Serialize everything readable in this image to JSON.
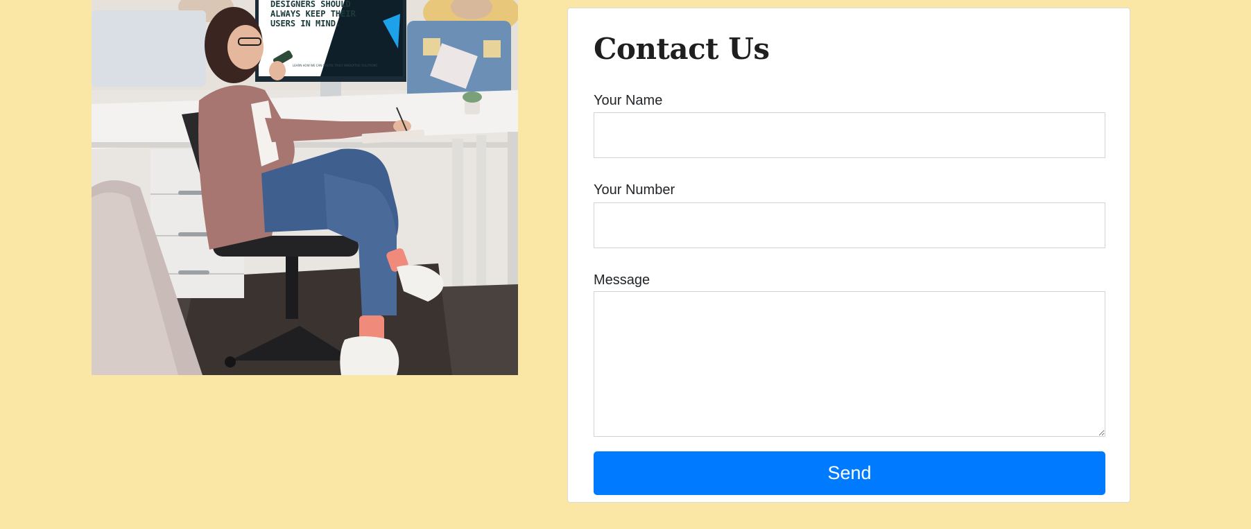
{
  "contact": {
    "title": "Contact Us",
    "fields": {
      "name": {
        "label": "Your Name",
        "value": "",
        "placeholder": ""
      },
      "number": {
        "label": "Your Number",
        "value": "",
        "placeholder": ""
      },
      "message": {
        "label": "Message",
        "value": "",
        "placeholder": ""
      }
    },
    "submit_label": "Send"
  },
  "photo": {
    "monitor_text": [
      "DESIGNERS SHOULD",
      "ALWAYS KEEP THEIR",
      "USERS IN MIND."
    ],
    "monitor_small_text": "LEARN HOW WE CAN CREATE TRULY INNOVATIVE SOLUTIONS"
  },
  "colors": {
    "page_background": "#fae7a5",
    "card_background": "#ffffff",
    "button_background": "#007bff",
    "button_text": "#ffffff"
  }
}
